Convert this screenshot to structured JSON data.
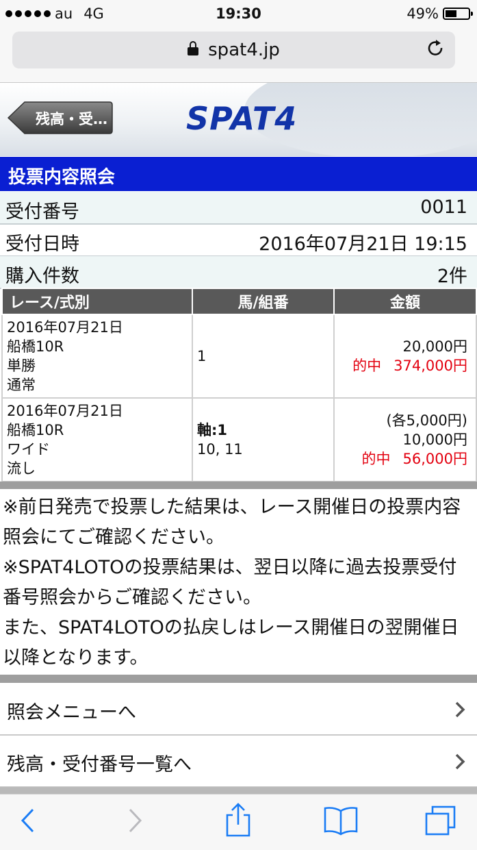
{
  "status": {
    "carrier": "au",
    "network": "4G",
    "time": "19:30",
    "battery": "49%",
    "battery_level": 0.49
  },
  "browser": {
    "url": "spat4.jp"
  },
  "header": {
    "back_label": "残高・受…",
    "logo": "SPAT4"
  },
  "page_title": "投票内容照会",
  "info": [
    {
      "label": "受付番号",
      "value": "0011"
    },
    {
      "label": "受付日時",
      "value": "2016年07月21日 19:15"
    },
    {
      "label": "購入件数",
      "value": "2件"
    }
  ],
  "table": {
    "headers": [
      "レース/式別",
      "馬/組番",
      "金額"
    ],
    "rows": [
      {
        "date": "2016年07月21日",
        "race": "船橋10R",
        "type": "単勝",
        "method": "通常",
        "horse_axis": "",
        "horse": "1",
        "each": "",
        "amount": "20,000円",
        "hit_label": "的中",
        "hit_amount": "374,000円"
      },
      {
        "date": "2016年07月21日",
        "race": "船橋10R",
        "type": "ワイド",
        "method": "流し",
        "horse_axis": "軸:1",
        "horse": "10, 11",
        "each": "(各5,000円)",
        "amount": "10,000円",
        "hit_label": "的中",
        "hit_amount": "56,000円"
      }
    ]
  },
  "notes": [
    "※前日発売で投票した結果は、レース開催日の投票内容照会にてご確認ください。",
    "※SPAT4LOTOの投票結果は、翌日以降に過去投票受付番号照会からご確認ください。",
    "また、SPAT4LOTOの払戻しはレース開催日の翌開催日以降となります。"
  ],
  "menu": [
    {
      "label": "照会メニューへ"
    },
    {
      "label": "残高・受付番号一覧へ"
    }
  ],
  "colors": {
    "title_bar": "#0a1fd2",
    "logo": "#1234a8",
    "hit": "#e3000f",
    "table_header": "#595959"
  }
}
